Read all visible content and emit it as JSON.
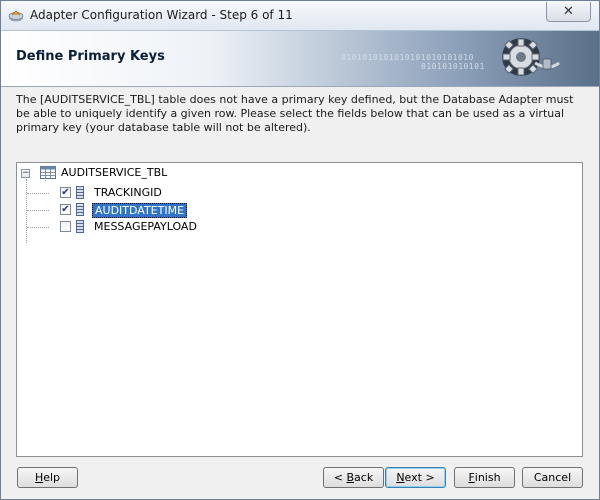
{
  "window": {
    "title": "Adapter Configuration Wizard - Step 6 of 11",
    "close_symbol": "✕"
  },
  "header": {
    "title": "Define Primary Keys",
    "decoration_binary_1": "0101010101010101010101010",
    "decoration_binary_2": "010101010101"
  },
  "description": "The [AUDITSERVICE_TBL] table does not have a primary key defined, but the Database Adapter must be able to uniquely identify a given row.  Please select the fields below that can be used as a virtual primary key (your database table will not be altered).",
  "tree": {
    "root": {
      "label": "AUDITSERVICE_TBL",
      "expanded": true,
      "expander_symbol": "−",
      "icon": "table-icon"
    },
    "columns": [
      {
        "label": "TRACKINGID",
        "checked": true,
        "selected": false,
        "check_symbol": "✔"
      },
      {
        "label": "AUDITDATETIME",
        "checked": true,
        "selected": true,
        "check_symbol": "✔"
      },
      {
        "label": "MESSAGEPAYLOAD",
        "checked": false,
        "selected": false,
        "check_symbol": ""
      }
    ]
  },
  "buttons": {
    "help": {
      "mnemonic": "H",
      "rest": "elp"
    },
    "back": {
      "pre": "< ",
      "mnemonic": "B",
      "rest": "ack"
    },
    "next": {
      "mnemonic": "N",
      "rest": "ext >"
    },
    "finish": {
      "mnemonic": "F",
      "rest": "inish"
    },
    "cancel": {
      "label": "Cancel"
    }
  },
  "colors": {
    "selection": "#3175c8",
    "header_gradient_end": "#5a7088"
  }
}
